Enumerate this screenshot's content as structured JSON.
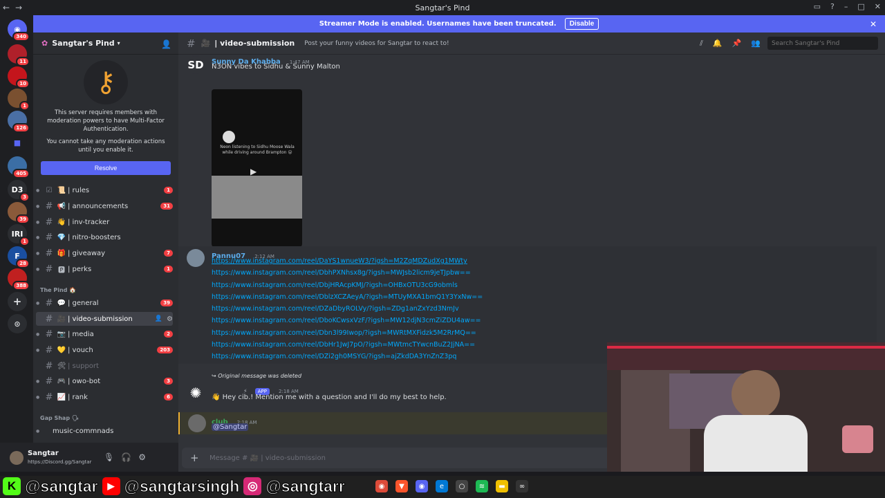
{
  "window": {
    "title": "Sangtar's Pind"
  },
  "banner": {
    "text": "Streamer Mode is enabled. Usernames have been truncated.",
    "button": "Disable"
  },
  "servers": [
    {
      "label": "",
      "badge": "340"
    },
    {
      "label": "",
      "badge": "11"
    },
    {
      "label": "",
      "badge": "10"
    },
    {
      "label": "",
      "badge": "1"
    },
    {
      "label": "",
      "badge": "126"
    },
    {
      "label": "",
      "badge": ""
    },
    {
      "label": "",
      "badge": "405"
    },
    {
      "label": "D3",
      "badge": "3"
    },
    {
      "label": "",
      "badge": "39"
    },
    {
      "label": "IRI",
      "badge": "1"
    },
    {
      "label": "F",
      "badge": "28"
    },
    {
      "label": "",
      "badge": "388"
    }
  ],
  "sidebar": {
    "server_name": "Sangtar's Pind",
    "mfa_text": "This server requires members with moderation powers to have Multi-Factor Authentication.",
    "mfa_sub": "You cannot take any moderation actions until you enable it.",
    "resolve": "Resolve",
    "channels_top": [
      {
        "emoji": "📜",
        "name": "| rules",
        "count": "1"
      },
      {
        "emoji": "📢",
        "name": "| announcements",
        "count": "31"
      },
      {
        "emoji": "👋",
        "name": "| inv-tracker",
        "count": ""
      },
      {
        "emoji": "💎",
        "name": "| nitro-boosters",
        "count": ""
      },
      {
        "emoji": "🎁",
        "name": "| giveaway",
        "count": "7"
      },
      {
        "emoji": "🅿",
        "name": "| perks",
        "count": "1"
      }
    ],
    "category1": "The Pind 🏠",
    "channels_mid": [
      {
        "emoji": "💬",
        "name": "| general",
        "count": "39"
      },
      {
        "emoji": "🎥",
        "name": "| video-submission",
        "count": ""
      },
      {
        "emoji": "📷",
        "name": "| media",
        "count": "2"
      },
      {
        "emoji": "💛",
        "name": "| vouch",
        "count": "203"
      },
      {
        "emoji": "🛠",
        "name": "| support",
        "count": ""
      },
      {
        "emoji": "🎮",
        "name": "| owo-bot",
        "count": "3"
      },
      {
        "emoji": "📈",
        "name": "| rank",
        "count": "6"
      }
    ],
    "category2": "Gap Shap 🗣",
    "channels_bottom": [
      {
        "emoji": "",
        "name": "music-commnads",
        "count": ""
      }
    ]
  },
  "user": {
    "name": "Sangtar",
    "status": "https://Discord.gg/Sangtar"
  },
  "channel_header": {
    "name": "| video-submission",
    "topic": "Post your funny videos for Sangtar to react to!",
    "search_placeholder": "Search Sangtar's Pind"
  },
  "messages": {
    "m1": {
      "avatar": "SD",
      "author": "Sunny Da Khabba",
      "time": "1:47 AM",
      "text": "N3ON vibes to Sidhu & Sunny Malton",
      "video_caption": "Neon listening to Sidhu Moose Wala while driving around Brampton 😮"
    },
    "m2": {
      "author": "Pannu07",
      "time": "2:12 AM",
      "links": [
        "https://www.instagram.com/reel/DaYS1wnueW3/?igsh=M2ZqMDZudXg1MWty",
        "https://www.instagram.com/reel/DbhPXNhsx8g/?igsh=MWJsb2licm9jeTJpbw==",
        "https://www.instagram.com/reel/DbjHRAcpKMJ/?igsh=OHBxOTU3cG9obmls",
        "https://www.instagram.com/reel/DblzXCZAeyA/?igsh=MTUyMXA1bmQ1Y3YxNw==",
        "https://www.instagram.com/reel/DZaDbyROLVy/?igsh=ZDg1anZxYzd3NmJv",
        "https://www.instagram.com/reel/DboKCwsxVzF/?igsh=MW12djN3cmZiZDU4aw==",
        "https://www.instagram.com/reel/Dbn3l99Iwop/?igsh=MWRtMXFidzk5M2RrMQ==",
        "https://www.instagram.com/reel/DbHr1JwJ7pO/?igsh=MWtmcTYwcnBuZ2JjNA==",
        "https://www.instagram.com/reel/DZi2gh0MSYG/?igsh=ajZkdDA3YnZnZ3pq"
      ]
    },
    "m3": {
      "reply": "Original message was deleted",
      "app": "APP",
      "time": "2:18 AM",
      "text": "👋 Hey cib.! Mention me with a question and I'll do my best to help."
    },
    "m4": {
      "author": "club",
      "time": "2:18 AM",
      "mention": "@Sangtar"
    }
  },
  "composer": {
    "placeholder": "Message # 🎥 | video-submission"
  },
  "overlay": {
    "handle1": "@sangtar",
    "handle2": "@sangtarsingh",
    "handle3": "@sangtarr"
  },
  "colors": {
    "accent": "#5865f2",
    "link": "#00a8fc",
    "badge": "#f23f43"
  }
}
